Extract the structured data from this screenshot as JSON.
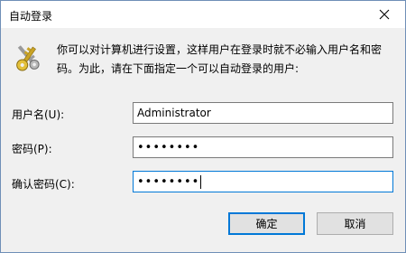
{
  "window": {
    "title": "自动登录",
    "close_icon": "close-icon"
  },
  "description": {
    "line1": "你可以对计算机进行设置，这样用户在登录时就不必输入用户名和密",
    "line2": "码。为此，请在下面指定一个可以自动登录的用户:",
    "icon": "keys-icon"
  },
  "form": {
    "username_label": "用户名(U):",
    "username_value": "Administrator",
    "password_label": "密码(P):",
    "password_value": "••••••••",
    "confirm_label": "确认密码(C):",
    "confirm_value": "••••••••"
  },
  "buttons": {
    "ok_label": "确定",
    "cancel_label": "取消"
  },
  "colors": {
    "accent": "#0078d7",
    "button_face": "#e1e1e1",
    "window_bg": "#f0f0f0"
  }
}
